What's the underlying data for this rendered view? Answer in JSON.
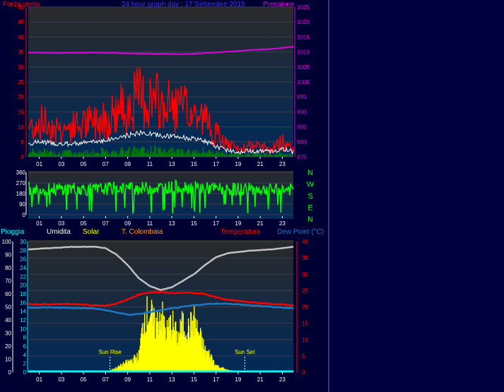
{
  "header": {
    "left_label": "Forza vento",
    "center_label": "24 hour graph day : 17 Settembre 2015",
    "right_label": "Pressione"
  },
  "colors": {
    "background": "#000040",
    "plot_top": "#2a2a2a",
    "plot_bottom": "#002a5a",
    "wind": "#ff0000",
    "wind_avg": "#ffffff",
    "wind_green": "#008000",
    "pressure": "#e000e0",
    "direction": "#00ff00",
    "humidity": "#c0c0c0",
    "solar": "#ffff00",
    "temperature": "#ff0000",
    "dew_point": "#1e78c8",
    "rain": "#00ffff",
    "right_axis_red": "#ff0000"
  },
  "chart_data": [
    {
      "type": "line",
      "title": "24 hour graph day : 17 Settembre 2015",
      "x_tick_labels": [
        "01",
        "03",
        "05",
        "07",
        "09",
        "11",
        "13",
        "15",
        "17",
        "19",
        "21",
        "23"
      ],
      "left_axis": {
        "label": "Forza vento",
        "ticks": [
          0,
          5,
          10,
          15,
          20,
          25,
          30,
          35,
          40,
          45,
          50
        ],
        "range": [
          0,
          50
        ]
      },
      "right_axis": {
        "label": "Pressione",
        "ticks": [
          975,
          980,
          985,
          990,
          995,
          1000,
          1005,
          1010,
          1015,
          1020,
          1025
        ],
        "range": [
          975,
          1025
        ]
      },
      "series": [
        {
          "name": "Pressione",
          "hours": [
            0,
            2,
            4,
            6,
            8,
            10,
            12,
            14,
            16,
            18,
            20,
            22,
            24
          ],
          "values": [
            1009.8,
            1009.7,
            1009.7,
            1009.8,
            1009.6,
            1009.5,
            1009.4,
            1009.3,
            1009.6,
            1010.1,
            1010.6,
            1011.0,
            1011.8
          ]
        },
        {
          "name": "Forza vento",
          "hours": [
            0,
            1,
            2,
            3,
            4,
            5,
            6,
            7,
            8,
            9,
            10,
            11,
            12,
            13,
            14,
            15,
            16,
            17,
            18,
            19,
            20,
            21,
            22,
            23,
            24
          ],
          "values": [
            12,
            14,
            13,
            11,
            12,
            13,
            14,
            16,
            18,
            21,
            24,
            23,
            21,
            20,
            19,
            17,
            15,
            9,
            5,
            3,
            4,
            4,
            3,
            6,
            3
          ]
        }
      ]
    },
    {
      "type": "line",
      "x_tick_labels": [
        "01",
        "03",
        "05",
        "07",
        "09",
        "11",
        "13",
        "15",
        "17",
        "19",
        "21",
        "23"
      ],
      "left_axis": {
        "ticks": [
          0,
          90,
          180,
          270,
          360
        ],
        "range": [
          0,
          360
        ]
      },
      "right_axis_labels": [
        "N",
        "W",
        "S",
        "E",
        "N"
      ],
      "series": [
        {
          "hours": [
            0,
            2,
            4,
            6,
            8,
            10,
            12,
            14,
            16,
            18,
            20,
            22,
            24
          ],
          "values": [
            220,
            215,
            225,
            210,
            230,
            225,
            230,
            240,
            225,
            215,
            220,
            210,
            215
          ]
        }
      ]
    },
    {
      "type": "line",
      "legend": [
        "Pioggia",
        "Umidita",
        "Solar",
        "T. Colombaia",
        "Temperatura",
        "Dew Point (°C)"
      ],
      "x_tick_labels": [
        "01",
        "03",
        "05",
        "07",
        "09",
        "11",
        "13",
        "15",
        "17",
        "19",
        "21",
        "23"
      ],
      "left_axis_1": {
        "label": "Pioggia",
        "ticks": [
          0,
          10,
          20,
          30,
          40,
          50,
          60,
          70,
          80,
          90,
          100
        ],
        "range": [
          0,
          100
        ]
      },
      "left_axis_2": {
        "ticks": [
          0,
          2,
          4,
          6,
          8,
          10,
          12,
          14,
          16,
          18,
          20,
          22,
          24,
          26,
          28,
          30
        ],
        "range": [
          0,
          30
        ]
      },
      "right_axis": {
        "label": "Temperatura",
        "ticks": [
          0,
          5,
          10,
          15,
          20,
          25,
          30,
          35,
          40
        ],
        "range": [
          0,
          40
        ]
      },
      "annotations": [
        {
          "text": "Sun Rise",
          "hour": 7.4
        },
        {
          "text": "Sun Set",
          "hour": 19.6
        }
      ],
      "series": [
        {
          "name": "Umidita",
          "hours": [
            0,
            2,
            4,
            6,
            7,
            8,
            9,
            10,
            11,
            12,
            13,
            14,
            15,
            16,
            17,
            18,
            20,
            22,
            24
          ],
          "values": [
            94,
            95,
            96,
            96,
            95,
            90,
            82,
            72,
            66,
            63,
            65,
            70,
            75,
            82,
            88,
            91,
            93,
            94,
            96
          ]
        },
        {
          "name": "Temperatura",
          "hours": [
            0,
            2,
            4,
            6,
            7,
            8,
            9,
            10,
            11,
            12,
            13,
            14,
            15,
            16,
            17,
            18,
            20,
            22,
            24
          ],
          "values": [
            20.8,
            20.8,
            20.9,
            20.5,
            20.4,
            21.0,
            22.2,
            23.8,
            24.5,
            24.5,
            24.2,
            24.4,
            24.3,
            23.9,
            23.0,
            22.2,
            21.4,
            20.9,
            20.5
          ]
        },
        {
          "name": "Dew Point (°C)",
          "hours": [
            0,
            2,
            4,
            6,
            7,
            8,
            9,
            10,
            11,
            12,
            13,
            14,
            15,
            16,
            17,
            18,
            20,
            22,
            24
          ],
          "values": [
            19.8,
            19.8,
            19.7,
            19.5,
            19.0,
            18.3,
            17.6,
            17.8,
            18.4,
            19.0,
            19.5,
            20.0,
            20.5,
            20.8,
            21.0,
            21.0,
            20.5,
            20.0,
            19.6
          ]
        },
        {
          "name": "Solar",
          "hours": [
            7,
            8,
            9,
            10,
            10.5,
            11,
            11.5,
            12,
            12.5,
            13,
            13.5,
            14,
            14.5,
            15,
            15.5,
            16,
            16.5,
            17,
            18,
            19.5
          ],
          "values": [
            0,
            4,
            9,
            14,
            50,
            54,
            40,
            54,
            35,
            45,
            30,
            43,
            38,
            46,
            33,
            19,
            15,
            6,
            2,
            0
          ]
        },
        {
          "name": "Pioggia",
          "hours": [
            0,
            24
          ],
          "values": [
            0.5,
            0.5
          ]
        }
      ]
    }
  ]
}
